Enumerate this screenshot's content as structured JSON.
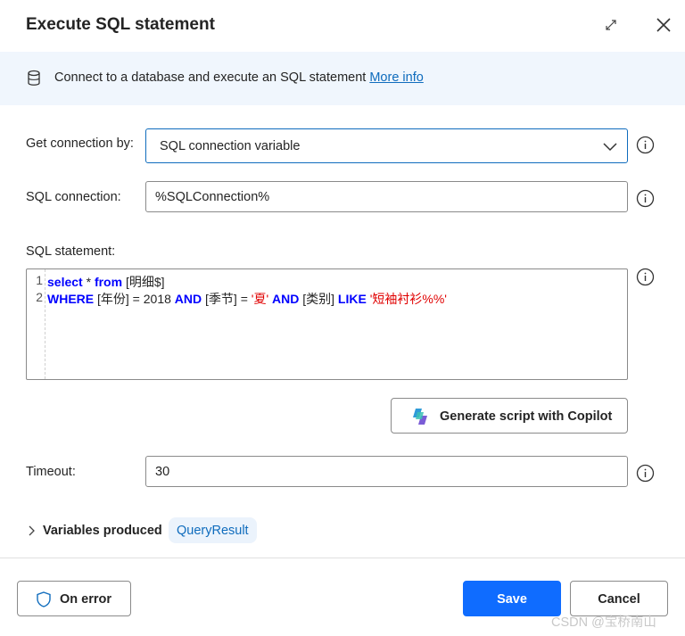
{
  "dialog": {
    "title": "Execute SQL statement",
    "expand_icon": "expand-icon",
    "close_icon": "close-icon"
  },
  "info_bar": {
    "icon": "database-icon",
    "text": "Connect to a database and execute an SQL statement ",
    "link": "More info"
  },
  "fields": {
    "connection_by": {
      "label": "Get connection by:",
      "value": "SQL connection variable"
    },
    "sql_connection": {
      "label": "SQL connection:",
      "value": "%SQLConnection%"
    },
    "sql_statement": {
      "label": "SQL statement:",
      "line_numbers": [
        "1",
        "2"
      ],
      "line1": {
        "kw1": "select",
        "t1": " * ",
        "kw2": "from",
        "t2": " [明细$]"
      },
      "line2": {
        "kw1": "WHERE",
        "t1": " [年份] = 2018 ",
        "kw2": "AND",
        "t2": " [季节] = ",
        "s1": "'夏'",
        "t3": " ",
        "kw3": "AND",
        "t4": " [类别] ",
        "kw4": "LIKE",
        "t5": " ",
        "s2": "'短袖衬衫%%'"
      }
    },
    "copilot_button": "Generate script with Copilot",
    "timeout": {
      "label": "Timeout:",
      "value": "30"
    }
  },
  "variables": {
    "label": "Variables produced",
    "items": [
      "QueryResult"
    ]
  },
  "footer": {
    "on_error": "On error",
    "save": "Save",
    "cancel": "Cancel"
  },
  "watermark": "CSDN @宝桥南山",
  "colors": {
    "accent": "#0f6cbd",
    "save_button": "#0f6cff",
    "info_bar_bg": "#f0f6fd",
    "keyword": "#0000ff",
    "string_literal": "#e00000"
  }
}
